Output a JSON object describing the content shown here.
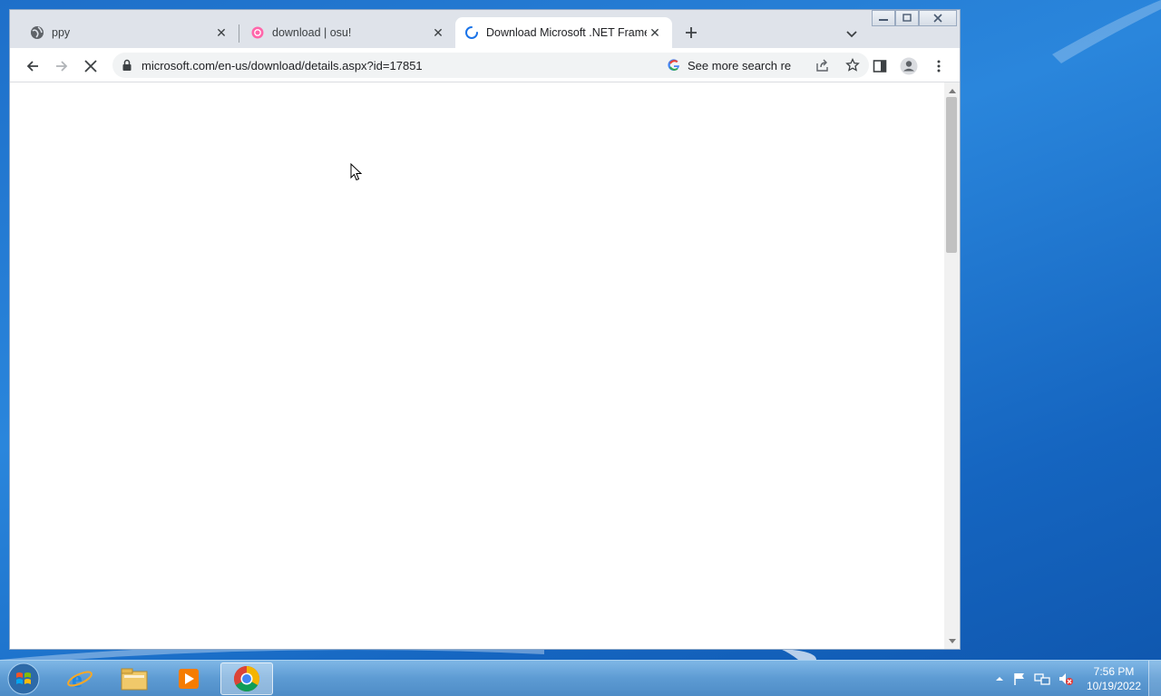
{
  "browser": {
    "tabs": [
      {
        "title": "ppy",
        "favicon": "globe-icon"
      },
      {
        "title": "download | osu!",
        "favicon": "osu-icon"
      },
      {
        "title": "Download Microsoft .NET Framew",
        "favicon": "loading-spinner-icon",
        "active": true
      }
    ],
    "new_tab_icon": "plus-icon",
    "window_controls": [
      "minimize-icon",
      "restore-icon",
      "close-icon"
    ],
    "toolbar": {
      "url": "microsoft.com/en-us/download/details.aspx?id=17851",
      "search_suggestion": "See more search re",
      "icons": [
        "back-icon",
        "forward-icon",
        "stop-loading-icon",
        "lock-icon",
        "google-icon",
        "share-icon",
        "bookmark-star-icon",
        "side-panel-icon",
        "profile-icon",
        "menu-icon"
      ]
    }
  },
  "taskbar": {
    "apps": [
      "internet-explorer-icon",
      "file-explorer-icon",
      "media-player-icon",
      "chrome-icon"
    ],
    "clock": {
      "time": "7:56 PM",
      "date": "10/19/2022"
    }
  },
  "colors": {
    "desktop": "#1e6fc9",
    "tabstrip": "#dfe3ea",
    "accent_blue": "#1a73e8"
  }
}
